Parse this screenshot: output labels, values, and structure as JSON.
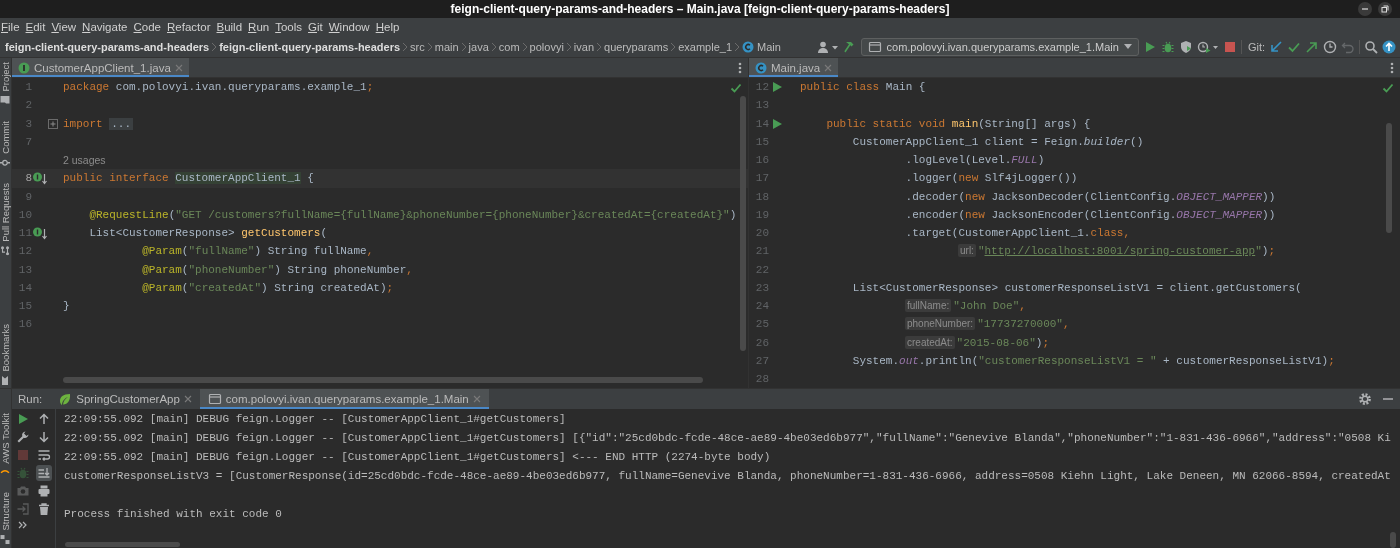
{
  "window": {
    "title": "feign-client-query-params-and-headers – Main.java [feign-client-query-params-headers]"
  },
  "menu": [
    "File",
    "Edit",
    "View",
    "Navigate",
    "Code",
    "Refactor",
    "Build",
    "Run",
    "Tools",
    "Git",
    "Window",
    "Help"
  ],
  "breadcrumbs": [
    {
      "kind": "module",
      "label": "feign-client-query-params-and-headers"
    },
    {
      "kind": "module",
      "label": "feign-client-query-params-headers"
    },
    {
      "kind": "folder",
      "label": "src"
    },
    {
      "kind": "folder",
      "label": "main"
    },
    {
      "kind": "folder",
      "label": "java"
    },
    {
      "kind": "folder",
      "label": "com"
    },
    {
      "kind": "folder",
      "label": "polovyi"
    },
    {
      "kind": "folder",
      "label": "ivan"
    },
    {
      "kind": "folder",
      "label": "queryparams"
    },
    {
      "kind": "folder",
      "label": "example_1"
    },
    {
      "kind": "class",
      "label": "Main"
    }
  ],
  "toolbar": {
    "tools": [
      {
        "kind": "user",
        "disabled": false
      },
      {
        "kind": "hammer",
        "disabled": false
      }
    ],
    "run_config": "com.polovyi.ivan.queryparams.example_1.Main",
    "run_actions": [
      {
        "kind": "run",
        "disabled": false
      },
      {
        "kind": "debug",
        "disabled": false
      },
      {
        "kind": "coverage",
        "disabled": false
      },
      {
        "kind": "profile",
        "disabled": false
      },
      {
        "kind": "stop",
        "disabled": false
      }
    ],
    "git_label": "Git:",
    "git_actions": [
      {
        "kind": "update",
        "disabled": false
      },
      {
        "kind": "commit",
        "disabled": false
      },
      {
        "kind": "push",
        "disabled": false
      },
      {
        "kind": "history",
        "disabled": false
      },
      {
        "kind": "revert",
        "disabled": true
      }
    ],
    "end_actions": [
      {
        "kind": "search",
        "disabled": false
      },
      {
        "kind": "ide_update",
        "disabled": false
      }
    ]
  },
  "side_tools": {
    "upper": [
      {
        "kind": "project",
        "label": "Project"
      },
      {
        "kind": "commit",
        "label": "Commit"
      },
      {
        "kind": "pull",
        "label": "Pull Requests"
      }
    ],
    "lower": [
      {
        "kind": "bookmark",
        "label": "Bookmarks"
      }
    ],
    "bottom": [
      {
        "kind": "aws",
        "label": "AWS Toolkit"
      },
      {
        "kind": "structure",
        "label": "Structure"
      }
    ]
  },
  "editors": [
    {
      "tab": {
        "kind": "interface",
        "label": "CustomerAppClient_1.java",
        "selected": true
      },
      "lines": [
        {
          "kind": "plain",
          "number": "1",
          "current": false,
          "segments": [
            {
              "kind": "kw",
              "text": "package "
            },
            {
              "kind": "plain",
              "text": "com.polovyi.ivan.queryparams.example_1"
            },
            {
              "kind": "kw",
              "text": ";"
            }
          ]
        },
        {
          "kind": "plain",
          "number": "2",
          "current": false
        },
        {
          "kind": "fold",
          "number": "3",
          "current": false,
          "segments": [
            {
              "kind": "kw",
              "text": "import "
            },
            {
              "kind": "folded",
              "text": "..."
            }
          ]
        },
        {
          "kind": "plain",
          "number": "7",
          "current": false
        },
        {
          "kind": "implemented",
          "number": "8",
          "usages": "2 usages",
          "current": true,
          "segments": [
            {
              "kind": "kw",
              "text": "public interface "
            },
            {
              "kind": "mark",
              "text": "CustomerAppClient_1"
            },
            {
              "kind": "plain",
              "text": " {"
            }
          ]
        },
        {
          "kind": "plain",
          "number": "9",
          "current": false
        },
        {
          "kind": "plain",
          "number": "10",
          "current": false,
          "segments": [
            {
              "kind": "ann",
              "text": "    @RequestLine"
            },
            {
              "kind": "plain",
              "text": "("
            },
            {
              "kind": "str",
              "text": "\"GET /customers?fullName={fullName}&phoneNumber={phoneNumber}&createdAt={createdAt}\""
            },
            {
              "kind": "plain",
              "text": ")"
            }
          ]
        },
        {
          "kind": "implemented",
          "number": "11",
          "current": false,
          "segments": [
            {
              "kind": "plain",
              "text": "    List<CustomerResponse> "
            },
            {
              "kind": "fn",
              "text": "getCustomers"
            },
            {
              "kind": "plain",
              "text": "("
            }
          ]
        },
        {
          "kind": "plain",
          "number": "12",
          "current": false,
          "segments": [
            {
              "kind": "ann",
              "text": "            @Param"
            },
            {
              "kind": "plain",
              "text": "("
            },
            {
              "kind": "str",
              "text": "\"fullName\""
            },
            {
              "kind": "plain",
              "text": ") String fullName"
            },
            {
              "kind": "kw",
              "text": ","
            }
          ]
        },
        {
          "kind": "plain",
          "number": "13",
          "current": false,
          "segments": [
            {
              "kind": "ann",
              "text": "            @Param"
            },
            {
              "kind": "plain",
              "text": "("
            },
            {
              "kind": "str",
              "text": "\"phoneNumber\""
            },
            {
              "kind": "plain",
              "text": ") String phoneNumber"
            },
            {
              "kind": "kw",
              "text": ","
            }
          ]
        },
        {
          "kind": "plain",
          "number": "14",
          "current": false,
          "segments": [
            {
              "kind": "ann",
              "text": "            @Param"
            },
            {
              "kind": "plain",
              "text": "("
            },
            {
              "kind": "str",
              "text": "\"createdAt\""
            },
            {
              "kind": "plain",
              "text": ") String createdAt)"
            },
            {
              "kind": "kw",
              "text": ";"
            }
          ]
        },
        {
          "kind": "plain",
          "number": "15",
          "current": false,
          "segments": [
            {
              "kind": "plain",
              "text": "}"
            }
          ]
        },
        {
          "kind": "plain",
          "number": "16",
          "current": false
        }
      ]
    },
    {
      "tab": {
        "kind": "class",
        "label": "Main.java",
        "selected": true
      },
      "lines": [
        {
          "kind": "run",
          "number": "12",
          "current": false,
          "segments": [
            {
              "kind": "kw",
              "text": "public class "
            },
            {
              "kind": "plain",
              "text": "Main {"
            }
          ]
        },
        {
          "kind": "plain",
          "number": "13",
          "current": false
        },
        {
          "kind": "run",
          "number": "14",
          "current": false,
          "segments": [
            {
              "kind": "kw",
              "text": "    public static void "
            },
            {
              "kind": "fn",
              "text": "main"
            },
            {
              "kind": "plain",
              "text": "(String[] args) {"
            }
          ]
        },
        {
          "kind": "plain",
          "number": "15",
          "current": false,
          "segments": [
            {
              "kind": "plain",
              "text": "        CustomerAppClient_1 client = Feign."
            },
            {
              "kind": "static",
              "text": "builder"
            },
            {
              "kind": "plain",
              "text": "()"
            }
          ]
        },
        {
          "kind": "plain",
          "number": "16",
          "current": false,
          "segments": [
            {
              "kind": "plain",
              "text": "                .logLevel(Level."
            },
            {
              "kind": "const",
              "text": "FULL"
            },
            {
              "kind": "plain",
              "text": ")"
            }
          ]
        },
        {
          "kind": "plain",
          "number": "17",
          "current": false,
          "segments": [
            {
              "kind": "plain",
              "text": "                .logger("
            },
            {
              "kind": "kw",
              "text": "new "
            },
            {
              "kind": "plain",
              "text": "Slf4jLogger())"
            }
          ]
        },
        {
          "kind": "plain",
          "number": "18",
          "current": false,
          "segments": [
            {
              "kind": "plain",
              "text": "                .decoder("
            },
            {
              "kind": "kw",
              "text": "new "
            },
            {
              "kind": "plain",
              "text": "JacksonDecoder(ClientConfig."
            },
            {
              "kind": "const",
              "text": "OBJECT_MAPPER"
            },
            {
              "kind": "plain",
              "text": "))"
            }
          ]
        },
        {
          "kind": "plain",
          "number": "19",
          "current": false,
          "segments": [
            {
              "kind": "plain",
              "text": "                .encoder("
            },
            {
              "kind": "kw",
              "text": "new "
            },
            {
              "kind": "plain",
              "text": "JacksonEncoder(ClientConfig."
            },
            {
              "kind": "const",
              "text": "OBJECT_MAPPER"
            },
            {
              "kind": "plain",
              "text": "))"
            }
          ]
        },
        {
          "kind": "plain",
          "number": "20",
          "current": false,
          "segments": [
            {
              "kind": "plain",
              "text": "                .target(CustomerAppClient_1."
            },
            {
              "kind": "kw",
              "text": "class,"
            }
          ]
        },
        {
          "kind": "plain",
          "number": "21",
          "current": false,
          "segments": [
            {
              "kind": "hint",
              "text": "url:"
            },
            {
              "kind": "str",
              "text": "\""
            },
            {
              "kind": "link",
              "text": "http://localhost:8001/spring-customer-app"
            },
            {
              "kind": "str",
              "text": "\""
            },
            {
              "kind": "plain",
              "text": ")"
            },
            {
              "kind": "kw",
              "text": ";"
            }
          ]
        },
        {
          "kind": "plain",
          "number": "22",
          "current": false
        },
        {
          "kind": "plain",
          "number": "23",
          "current": false,
          "segments": [
            {
              "kind": "plain",
              "text": "        List<CustomerResponse> customerResponseListV1 = client.getCustomers("
            }
          ]
        },
        {
          "kind": "plain",
          "number": "24",
          "current": false,
          "segments": [
            {
              "kind": "hint",
              "text": "fullName:"
            },
            {
              "kind": "str",
              "text": "\"John Doe\""
            },
            {
              "kind": "kw",
              "text": ","
            }
          ]
        },
        {
          "kind": "plain",
          "number": "25",
          "current": false,
          "segments": [
            {
              "kind": "hint",
              "text": "phoneNumber:"
            },
            {
              "kind": "str",
              "text": "\"17737270000\""
            },
            {
              "kind": "kw",
              "text": ","
            }
          ]
        },
        {
          "kind": "plain",
          "number": "26",
          "current": false,
          "segments": [
            {
              "kind": "hint",
              "text": "createdAt:"
            },
            {
              "kind": "str",
              "text": "\"2015-08-06\""
            },
            {
              "kind": "plain",
              "text": ")"
            },
            {
              "kind": "kw",
              "text": ";"
            }
          ]
        },
        {
          "kind": "plain",
          "number": "27",
          "current": false,
          "segments": [
            {
              "kind": "plain",
              "text": "        System."
            },
            {
              "kind": "const",
              "text": "out"
            },
            {
              "kind": "plain",
              "text": ".println("
            },
            {
              "kind": "str",
              "text": "\"customerResponseListV1 = \""
            },
            {
              "kind": "plain",
              "text": " + customerResponseListV1)"
            },
            {
              "kind": "kw",
              "text": ";"
            }
          ]
        },
        {
          "kind": "plain",
          "number": "28",
          "current": false
        }
      ]
    }
  ],
  "run_panel": {
    "label": "Run:",
    "tabs": [
      {
        "kind": "spring",
        "label": "SpringCustomerApp",
        "selected": false
      },
      {
        "kind": "app",
        "label": "com.polovyi.ivan.queryparams.example_1.Main",
        "selected": true
      }
    ],
    "tools": {
      "left": [
        {
          "kind": "run",
          "disabled": false
        },
        {
          "kind": "wrench",
          "disabled": false
        },
        {
          "kind": "stop",
          "disabled": true
        },
        {
          "kind": "debug",
          "disabled": true
        },
        {
          "kind": "camera",
          "disabled": true
        },
        {
          "kind": "enter",
          "disabled": true
        },
        {
          "kind": "more",
          "disabled": false
        }
      ],
      "right": [
        {
          "kind": "up",
          "on": false
        },
        {
          "kind": "down",
          "on": false
        },
        {
          "kind": "wrap",
          "on": false
        },
        {
          "kind": "scrollend",
          "on": true
        },
        {
          "kind": "print",
          "on": false
        },
        {
          "kind": "trash",
          "on": false
        }
      ]
    },
    "output": [
      [
        "22:09:55.092 [main] DEBUG feign.Logger -- [CustomerAppClient_1#getCustomers]",
        "22:09:55.092 [main] DEBUG feign.Logger -- [CustomerAppClient_1#getCustomers] [{\"id\":\"25cd0bdc-fcde-48ce-ae89-4be03ed6b977\",\"fullName\":\"Genevive Blanda\",\"phoneNumber\":\"1-831-436-6966\",\"address\":\"0508 Ki",
        "22:09:55.092 [main] DEBUG feign.Logger -- [CustomerAppClient_1#getCustomers] <--- END HTTP (2274-byte body)",
        "customerResponseListV3 = [CustomerResponse(id=25cd0bdc-fcde-48ce-ae89-4be03ed6b977, fullName=Genevive Blanda, phoneNumber=1-831-436-6966, address=0508 Kiehn Light, Lake Deneen, MN 62066-8594, createdAt"
      ],
      [
        "Process finished with exit code 0"
      ]
    ]
  }
}
